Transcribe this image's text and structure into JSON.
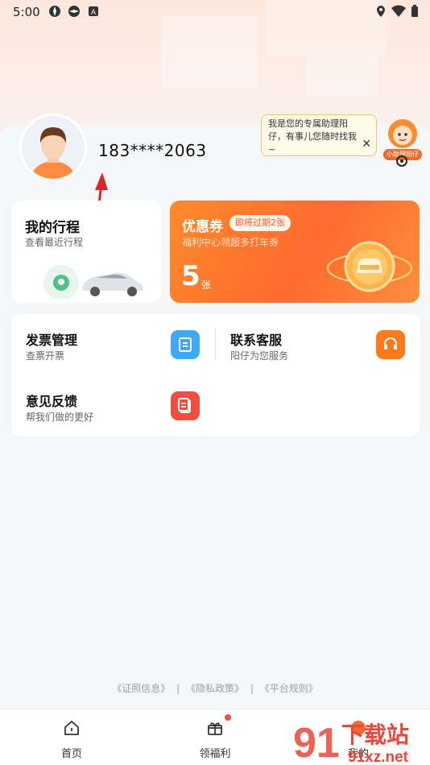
{
  "status_bar": {
    "time": "5:00",
    "left_icons": [
      "aperture-icon",
      "aperture-icon",
      "a-badge-icon"
    ],
    "right_icons": [
      "location-icon",
      "wifi-icon",
      "battery-icon"
    ]
  },
  "profile": {
    "phone": "183****2063",
    "avatar": "avatar"
  },
  "assistant": {
    "bubble_text": "我是您的专属助理阳仔，有事儿您随时找我~",
    "mascot_tag": "小助理阳仔"
  },
  "trip_card": {
    "title": "我的行程",
    "subtitle": "查看最近行程"
  },
  "coupon_card": {
    "title": "优惠券",
    "badge": "即将过期2张",
    "subtitle": "福利中心领超多打车券",
    "count": "5",
    "unit": "张"
  },
  "menu": {
    "invoice": {
      "title": "发票管理",
      "subtitle": "查票开票"
    },
    "service": {
      "title": "联系客服",
      "subtitle": "阳仔为您服务"
    },
    "feedback": {
      "title": "意见反馈",
      "subtitle": "帮我们做的更好"
    }
  },
  "footer": {
    "license": "《证照信息》",
    "privacy": "《隐私政策》",
    "rules": "《平台规则》",
    "sep": "|"
  },
  "tabs": [
    {
      "label": "首页",
      "icon": "home-icon"
    },
    {
      "label": "领福利",
      "icon": "gift-icon"
    },
    {
      "label": "我的",
      "icon": "user-icon"
    }
  ],
  "watermark": {
    "text_top": "下载站",
    "text_bottom": "91xz.net"
  },
  "colors": {
    "accent": "#ff6a2e",
    "invoice_icon": "#3fa9f5",
    "service_icon": "#ff7a1a",
    "feedback_icon": "#f04e3e"
  }
}
